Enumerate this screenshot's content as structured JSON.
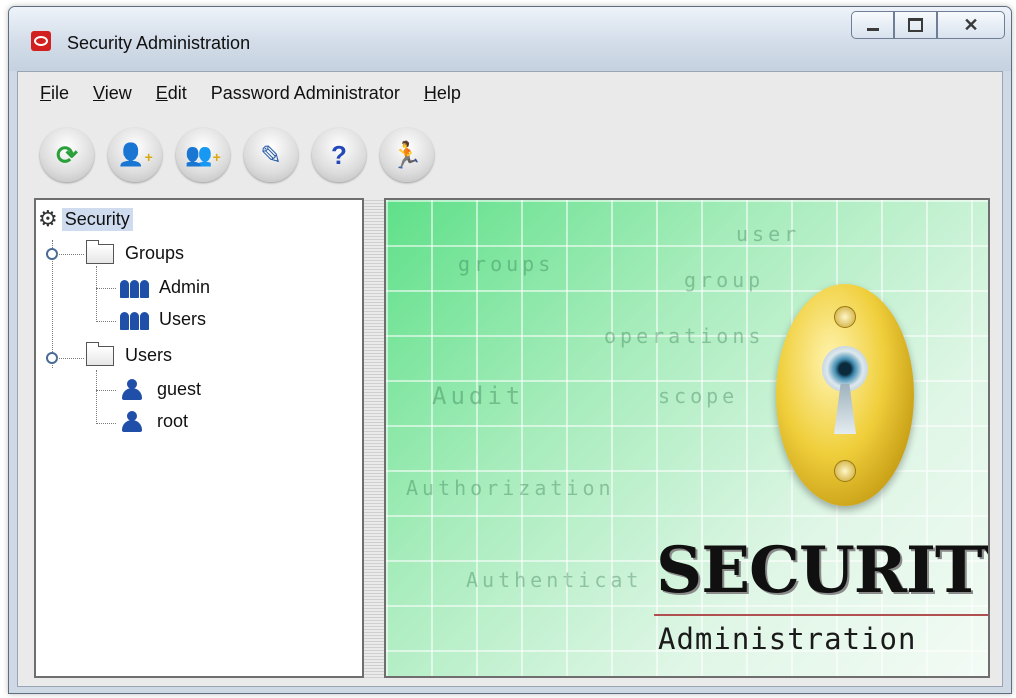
{
  "window": {
    "title": "Security Administration"
  },
  "menu": {
    "file": {
      "mnemonic": "F",
      "rest": "ile"
    },
    "view": {
      "mnemonic": "V",
      "rest": "iew"
    },
    "edit": {
      "mnemonic": "E",
      "rest": "dit"
    },
    "password_admin": "Password Administrator",
    "help": {
      "mnemonic": "H",
      "rest": "elp"
    }
  },
  "toolbar": [
    {
      "icon": "refresh-icon"
    },
    {
      "icon": "add-user-icon"
    },
    {
      "icon": "add-group-icon"
    },
    {
      "icon": "edit-icon"
    },
    {
      "icon": "help-icon"
    },
    {
      "icon": "exit-icon"
    }
  ],
  "tree": {
    "root": "Security",
    "groups_label": "Groups",
    "groups": [
      "Admin",
      "Users"
    ],
    "users_label": "Users",
    "users": [
      "guest",
      "root"
    ]
  },
  "splash": {
    "watermarks": {
      "user": "user",
      "groups": "groups",
      "group": "group",
      "operations": "operations",
      "audit": "Audit",
      "scope": "scope",
      "authorization": "Authorization",
      "authentication": "Authenticat"
    },
    "logo_title": "SECURITY",
    "logo_subtitle": "Administration"
  },
  "colors": {
    "selection": "#cfdcf0",
    "splash_green": "#5fe089",
    "icon_blue": "#1f4fa8",
    "lock_gold": "#f0cf3c"
  }
}
